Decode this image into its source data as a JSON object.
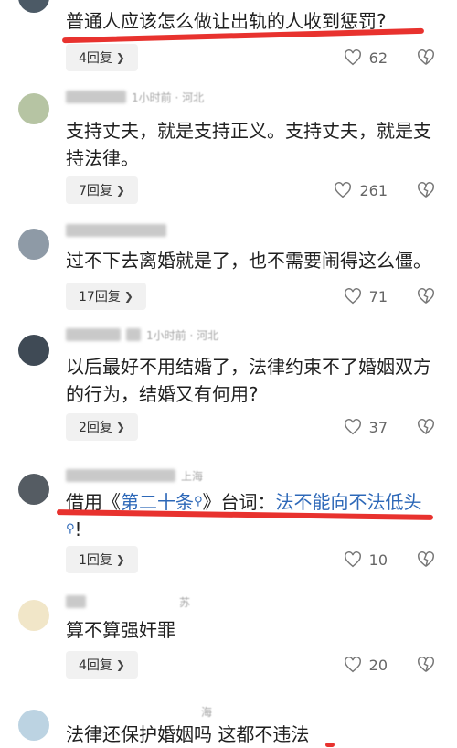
{
  "comments": [
    {
      "text": "普通人应该怎么做让出轨的人收到惩罚?",
      "meta": "",
      "replies": "4回复",
      "likes": "62"
    },
    {
      "text": "支持丈夫，就是支持正义。支持丈夫，就是支持法律。",
      "meta": "1小时前 · 河北",
      "replies": "7回复",
      "likes": "261"
    },
    {
      "text": "过不下去离婚就是了，也不需要闹得这么僵。",
      "meta": "",
      "replies": "17回复",
      "likes": "71"
    },
    {
      "text": "以后最好不用结婚了，法律约束不了婚姻双方的行为，结婚又有何用?",
      "meta": "1小时前 · 河北",
      "replies": "2回复",
      "likes": "37"
    },
    {
      "text_pre": "借用《",
      "text_link1": "第二十条",
      "text_mid": "》台词：",
      "text_link2": "法不能向不法低头",
      "text_post": "!",
      "meta": "上海",
      "replies": "1回复",
      "likes": "10"
    },
    {
      "text": "算不算强奸罪",
      "meta": "苏",
      "replies": "4回复",
      "likes": "20"
    },
    {
      "text": "法律还保护婚姻吗 这都不违法",
      "meta": "海"
    }
  ]
}
